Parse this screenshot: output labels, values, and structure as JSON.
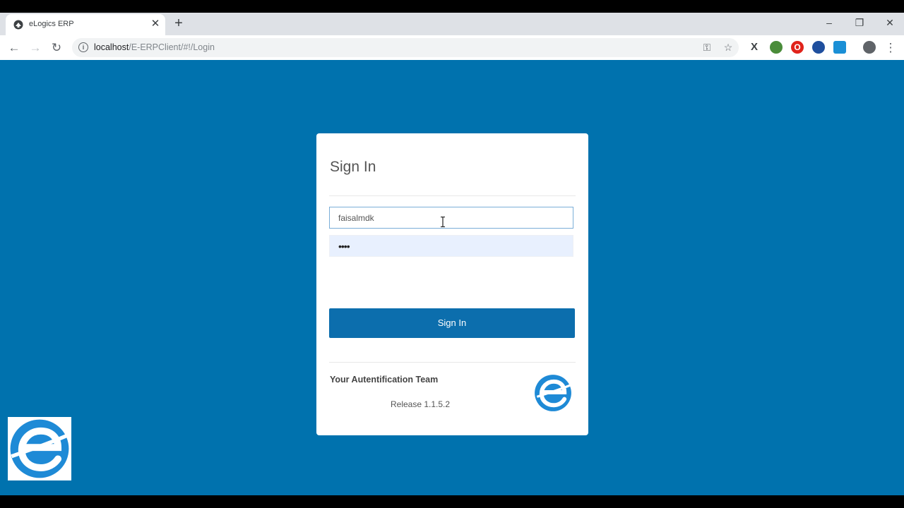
{
  "browser": {
    "tab_title": "eLogics ERP",
    "tab_close_icon": "close-icon",
    "new_tab_symbol": "+",
    "url_host": "localhost",
    "url_path": "/E-ERPClient/#!/Login",
    "window_controls": [
      "minimize-icon",
      "restore-icon",
      "close-icon"
    ]
  },
  "login": {
    "title": "Sign In",
    "username_value": "faisalmdk",
    "password_mask": "••••",
    "submit_label": "Sign In",
    "team_text": "Your Autentification Team",
    "release_text": "Release 1.1.5.2"
  },
  "colors": {
    "page_background": "#0072ae",
    "button_background": "#0c6ead",
    "logo_blue": "#1e8ad6"
  }
}
